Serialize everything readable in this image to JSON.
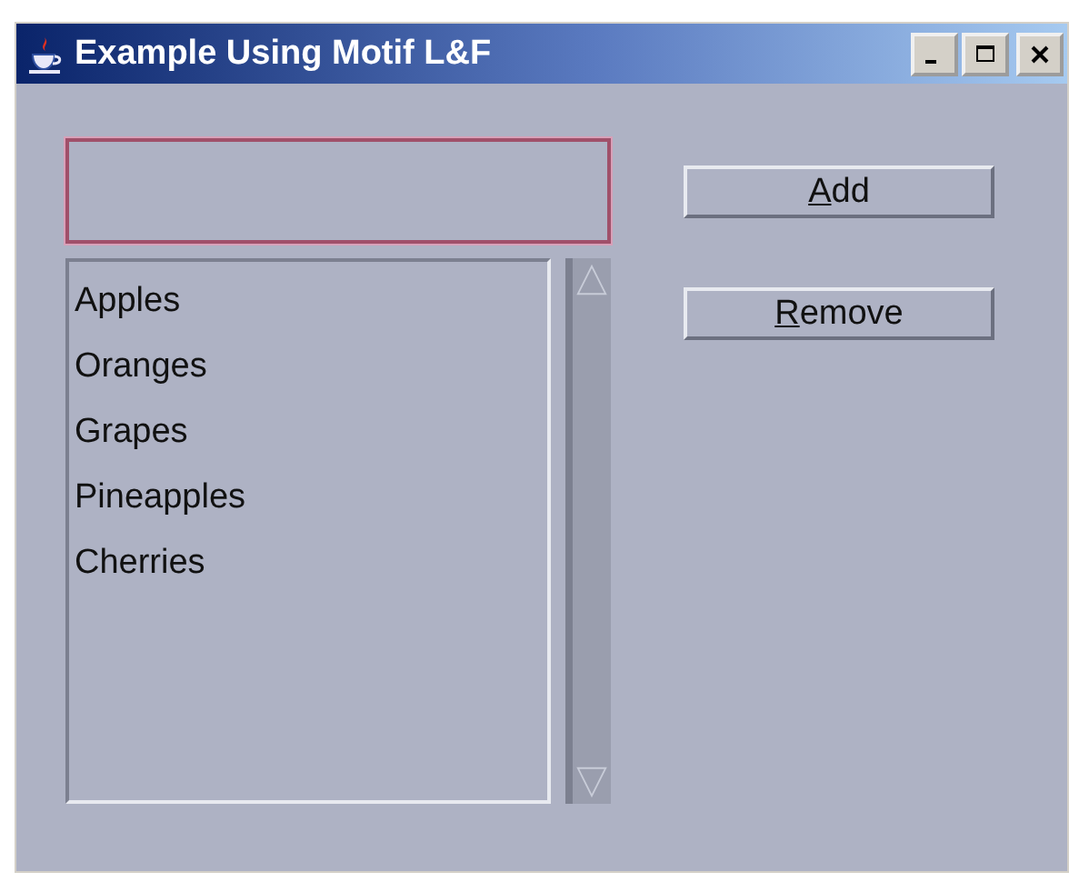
{
  "window": {
    "title": "Example Using Motif L&F"
  },
  "text_field": {
    "focused": true
  },
  "list": {
    "items": [
      {
        "label": "Apples",
        "selected": false
      },
      {
        "label": "Oranges",
        "selected": false
      },
      {
        "label": "Grapes",
        "selected": false
      },
      {
        "label": "Pineapples",
        "selected": false
      },
      {
        "label": "Cherries",
        "selected": false
      }
    ]
  },
  "buttons": [
    {
      "label": "Add",
      "mnemonic_underlined": true
    },
    {
      "label": "Remove",
      "mnemonic_underlined": true
    }
  ]
}
